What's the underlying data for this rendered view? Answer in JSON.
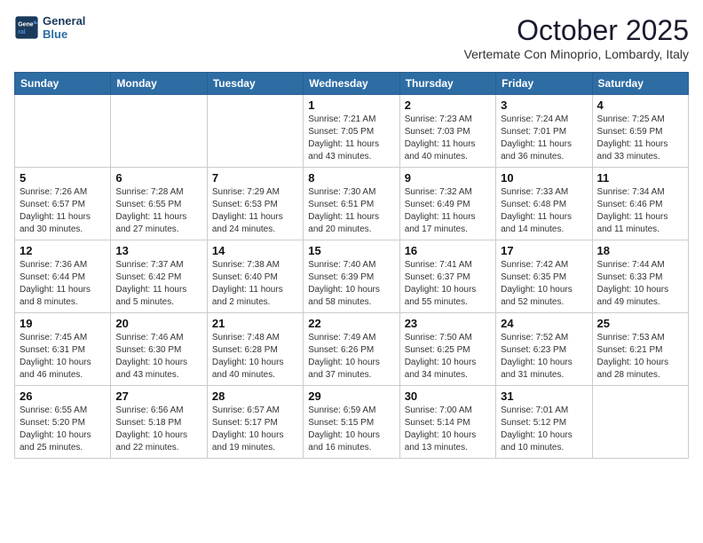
{
  "header": {
    "logo_line1": "General",
    "logo_line2": "Blue",
    "month": "October 2025",
    "location": "Vertemate Con Minoprio, Lombardy, Italy"
  },
  "weekdays": [
    "Sunday",
    "Monday",
    "Tuesday",
    "Wednesday",
    "Thursday",
    "Friday",
    "Saturday"
  ],
  "weeks": [
    [
      {
        "day": "",
        "info": ""
      },
      {
        "day": "",
        "info": ""
      },
      {
        "day": "",
        "info": ""
      },
      {
        "day": "1",
        "info": "Sunrise: 7:21 AM\nSunset: 7:05 PM\nDaylight: 11 hours\nand 43 minutes."
      },
      {
        "day": "2",
        "info": "Sunrise: 7:23 AM\nSunset: 7:03 PM\nDaylight: 11 hours\nand 40 minutes."
      },
      {
        "day": "3",
        "info": "Sunrise: 7:24 AM\nSunset: 7:01 PM\nDaylight: 11 hours\nand 36 minutes."
      },
      {
        "day": "4",
        "info": "Sunrise: 7:25 AM\nSunset: 6:59 PM\nDaylight: 11 hours\nand 33 minutes."
      }
    ],
    [
      {
        "day": "5",
        "info": "Sunrise: 7:26 AM\nSunset: 6:57 PM\nDaylight: 11 hours\nand 30 minutes."
      },
      {
        "day": "6",
        "info": "Sunrise: 7:28 AM\nSunset: 6:55 PM\nDaylight: 11 hours\nand 27 minutes."
      },
      {
        "day": "7",
        "info": "Sunrise: 7:29 AM\nSunset: 6:53 PM\nDaylight: 11 hours\nand 24 minutes."
      },
      {
        "day": "8",
        "info": "Sunrise: 7:30 AM\nSunset: 6:51 PM\nDaylight: 11 hours\nand 20 minutes."
      },
      {
        "day": "9",
        "info": "Sunrise: 7:32 AM\nSunset: 6:49 PM\nDaylight: 11 hours\nand 17 minutes."
      },
      {
        "day": "10",
        "info": "Sunrise: 7:33 AM\nSunset: 6:48 PM\nDaylight: 11 hours\nand 14 minutes."
      },
      {
        "day": "11",
        "info": "Sunrise: 7:34 AM\nSunset: 6:46 PM\nDaylight: 11 hours\nand 11 minutes."
      }
    ],
    [
      {
        "day": "12",
        "info": "Sunrise: 7:36 AM\nSunset: 6:44 PM\nDaylight: 11 hours\nand 8 minutes."
      },
      {
        "day": "13",
        "info": "Sunrise: 7:37 AM\nSunset: 6:42 PM\nDaylight: 11 hours\nand 5 minutes."
      },
      {
        "day": "14",
        "info": "Sunrise: 7:38 AM\nSunset: 6:40 PM\nDaylight: 11 hours\nand 2 minutes."
      },
      {
        "day": "15",
        "info": "Sunrise: 7:40 AM\nSunset: 6:39 PM\nDaylight: 10 hours\nand 58 minutes."
      },
      {
        "day": "16",
        "info": "Sunrise: 7:41 AM\nSunset: 6:37 PM\nDaylight: 10 hours\nand 55 minutes."
      },
      {
        "day": "17",
        "info": "Sunrise: 7:42 AM\nSunset: 6:35 PM\nDaylight: 10 hours\nand 52 minutes."
      },
      {
        "day": "18",
        "info": "Sunrise: 7:44 AM\nSunset: 6:33 PM\nDaylight: 10 hours\nand 49 minutes."
      }
    ],
    [
      {
        "day": "19",
        "info": "Sunrise: 7:45 AM\nSunset: 6:31 PM\nDaylight: 10 hours\nand 46 minutes."
      },
      {
        "day": "20",
        "info": "Sunrise: 7:46 AM\nSunset: 6:30 PM\nDaylight: 10 hours\nand 43 minutes."
      },
      {
        "day": "21",
        "info": "Sunrise: 7:48 AM\nSunset: 6:28 PM\nDaylight: 10 hours\nand 40 minutes."
      },
      {
        "day": "22",
        "info": "Sunrise: 7:49 AM\nSunset: 6:26 PM\nDaylight: 10 hours\nand 37 minutes."
      },
      {
        "day": "23",
        "info": "Sunrise: 7:50 AM\nSunset: 6:25 PM\nDaylight: 10 hours\nand 34 minutes."
      },
      {
        "day": "24",
        "info": "Sunrise: 7:52 AM\nSunset: 6:23 PM\nDaylight: 10 hours\nand 31 minutes."
      },
      {
        "day": "25",
        "info": "Sunrise: 7:53 AM\nSunset: 6:21 PM\nDaylight: 10 hours\nand 28 minutes."
      }
    ],
    [
      {
        "day": "26",
        "info": "Sunrise: 6:55 AM\nSunset: 5:20 PM\nDaylight: 10 hours\nand 25 minutes."
      },
      {
        "day": "27",
        "info": "Sunrise: 6:56 AM\nSunset: 5:18 PM\nDaylight: 10 hours\nand 22 minutes."
      },
      {
        "day": "28",
        "info": "Sunrise: 6:57 AM\nSunset: 5:17 PM\nDaylight: 10 hours\nand 19 minutes."
      },
      {
        "day": "29",
        "info": "Sunrise: 6:59 AM\nSunset: 5:15 PM\nDaylight: 10 hours\nand 16 minutes."
      },
      {
        "day": "30",
        "info": "Sunrise: 7:00 AM\nSunset: 5:14 PM\nDaylight: 10 hours\nand 13 minutes."
      },
      {
        "day": "31",
        "info": "Sunrise: 7:01 AM\nSunset: 5:12 PM\nDaylight: 10 hours\nand 10 minutes."
      },
      {
        "day": "",
        "info": ""
      }
    ]
  ]
}
